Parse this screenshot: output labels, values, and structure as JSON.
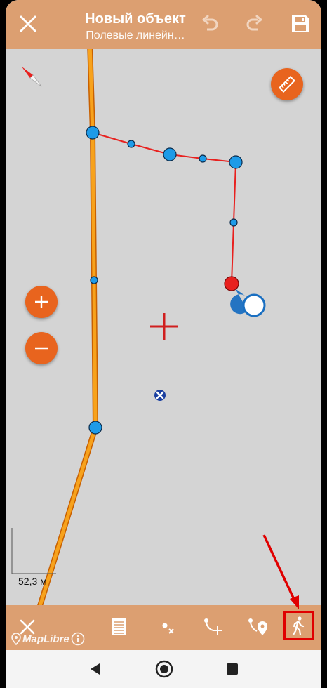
{
  "appbar": {
    "title": "Новый объект",
    "subtitle": "Полевые линейн…",
    "icons": [
      "close-icon",
      "undo-icon",
      "redo-icon",
      "save-icon"
    ]
  },
  "map": {
    "scale_label": "52,3 м",
    "attribution": "MapLibre",
    "buttons": [
      "compass-icon",
      "ruler-icon",
      "zoom-in-icon",
      "zoom-out-icon"
    ]
  },
  "toolbar": {
    "icons": [
      "close-icon",
      "attributes-icon",
      "delete-point-icon",
      "add-point-icon",
      "add-point-gps-icon",
      "walk-mode-icon"
    ],
    "highlighted": "walk-mode-icon"
  },
  "navbar": {
    "icons": [
      "back-icon",
      "home-icon",
      "recents-icon"
    ]
  },
  "colors": {
    "appbar": "#dc9f71",
    "accent": "#e8641e",
    "map": "#d4d4d4",
    "vertex": "#1e9be8",
    "selected_vertex": "#e8201e",
    "highlight": "#e00000"
  }
}
